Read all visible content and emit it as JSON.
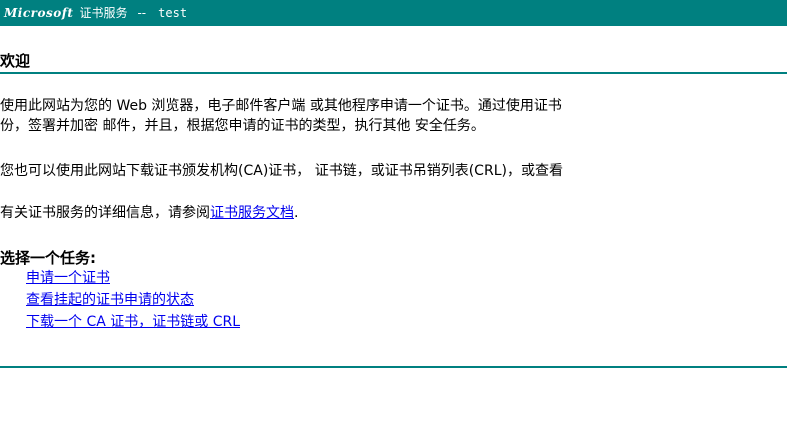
{
  "banner": {
    "brand": "Microsoft",
    "service": "证书服务",
    "separator": "--",
    "host": "test"
  },
  "welcome": {
    "title": "欢迎"
  },
  "paragraphs": {
    "p1_line1": "使用此网站为您的 Web 浏览器，电子邮件客户端 或其他程序申请一个证书。通过使用证书",
    "p1_line2": "份，签署并加密 邮件，并且，根据您申请的证书的类型，执行其他 安全任务。",
    "p2": "您也可以使用此网站下载证书颁发机构(CA)证书， 证书链，或证书吊销列表(CRL)，或查看",
    "p3_prefix": "有关证书服务的详细信息，请参阅",
    "p3_link": "证书服务文档",
    "p3_suffix": "."
  },
  "tasks": {
    "title": "选择一个任务:",
    "items": [
      "申请一个证书",
      "查看挂起的证书申请的状态",
      "下载一个 CA 证书，证书链或 CRL"
    ]
  },
  "colors": {
    "banner_bg": "#008080",
    "rule": "#008080",
    "link": "#0000ee"
  }
}
